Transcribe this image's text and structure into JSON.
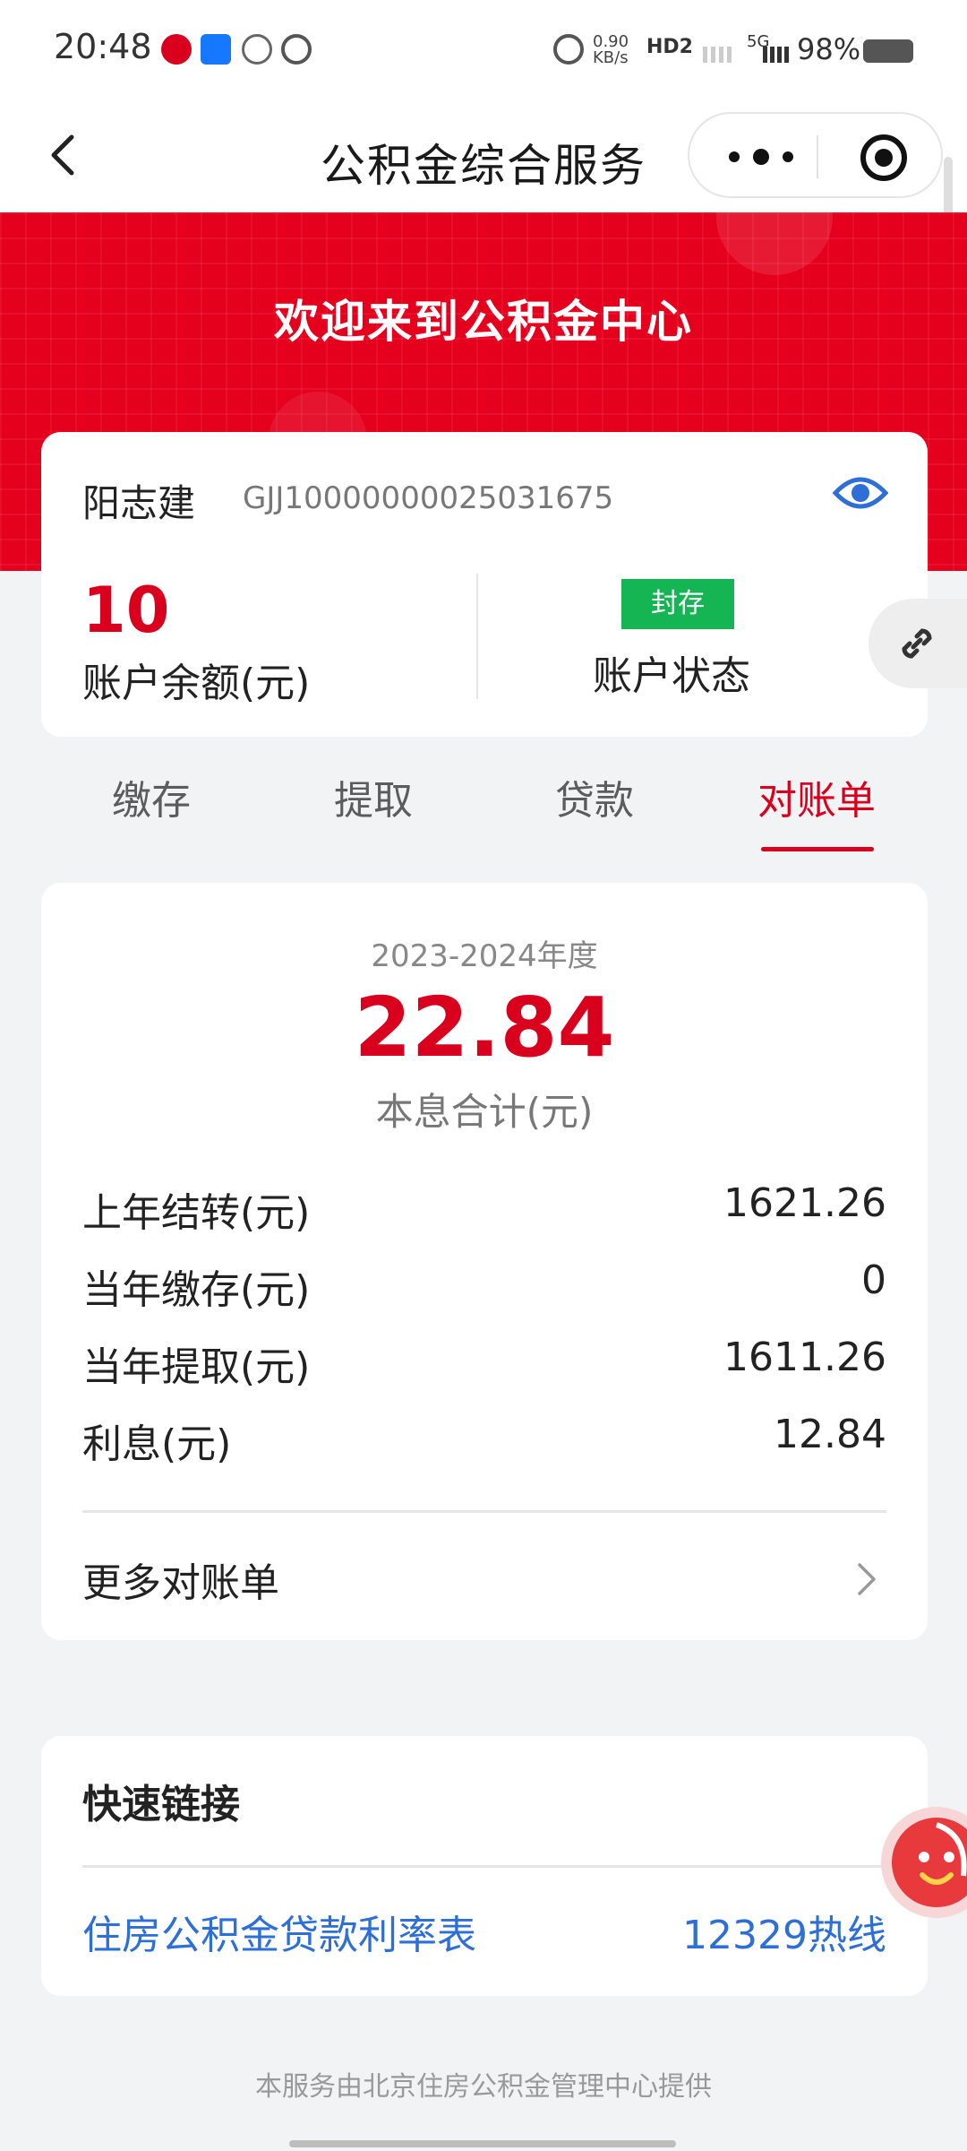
{
  "status_bar": {
    "time": "20:48",
    "network_speed": "0.90 KB/s",
    "hd_label": "HD2",
    "signal_label": "5G",
    "battery_percent": "98%"
  },
  "nav": {
    "title": "公积金综合服务"
  },
  "banner": {
    "title": "欢迎来到公积金中心"
  },
  "account": {
    "name": "阳志建",
    "account_no": "GJJ10000000025031675",
    "balance_value": "10",
    "balance_label": "账户余额(元)",
    "status_badge": "封存",
    "status_label": "账户状态"
  },
  "tabs": [
    {
      "label": "缴存",
      "active": false
    },
    {
      "label": "提取",
      "active": false
    },
    {
      "label": "贷款",
      "active": false
    },
    {
      "label": "对账单",
      "active": true
    }
  ],
  "statement": {
    "year": "2023-2024年度",
    "total_value": "22.84",
    "total_label": "本息合计(元)",
    "rows": [
      {
        "label": "上年结转(元)",
        "value": "1621.26"
      },
      {
        "label": "当年缴存(元)",
        "value": "0"
      },
      {
        "label": "当年提取(元)",
        "value": "1611.26"
      },
      {
        "label": "利息(元)",
        "value": "12.84"
      }
    ],
    "more_label": "更多对账单"
  },
  "quick_links": {
    "title": "快速链接",
    "left_link": "住房公积金贷款利率表",
    "right_link": "12329热线"
  },
  "footer": {
    "note": "本服务由北京住房公积金管理中心提供"
  },
  "colors": {
    "brand_red": "#e5001e",
    "accent_red": "#d8001d",
    "status_green": "#16b553",
    "link_blue": "#2d6fd6"
  }
}
